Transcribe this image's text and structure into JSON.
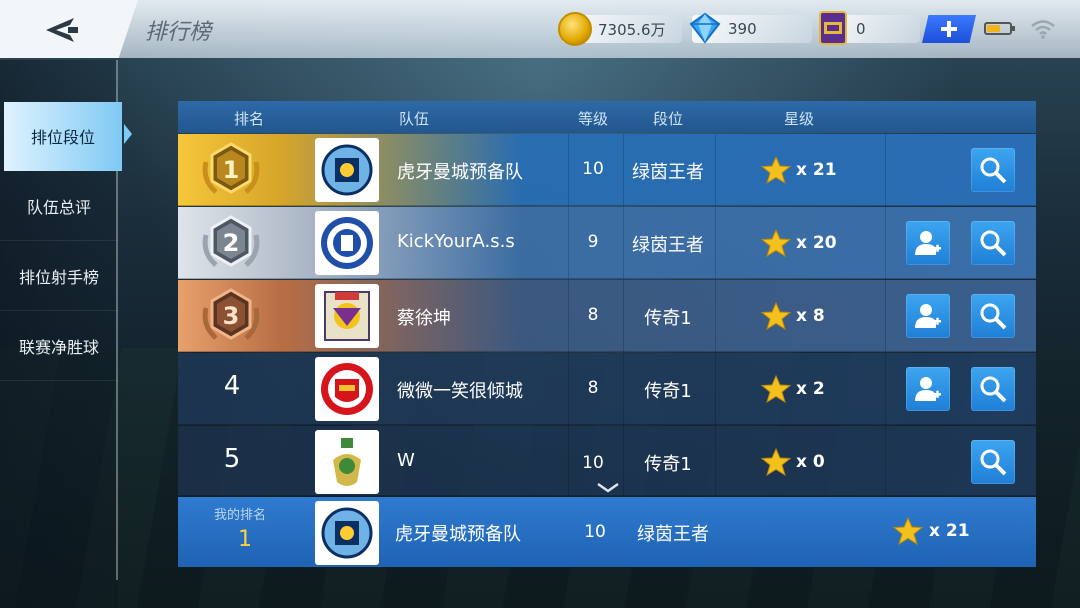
{
  "header": {
    "title": "排行榜",
    "coins": "7305.6万",
    "diamonds": "390",
    "cards": "0"
  },
  "sidebar": {
    "items": [
      {
        "label": "排位段位",
        "active": true
      },
      {
        "label": "队伍总评",
        "active": false
      },
      {
        "label": "排位射手榜",
        "active": false
      },
      {
        "label": "联赛净胜球",
        "active": false
      }
    ]
  },
  "table": {
    "headers": {
      "rank": "排名",
      "team": "队伍",
      "level": "等级",
      "tier": "段位",
      "stars": "星级"
    },
    "rows": [
      {
        "rank": "1",
        "team": "虎牙曼城预备队",
        "level": "10",
        "tier": "绿茵王者",
        "stars": "x 21",
        "medal": "gold",
        "add_friend": false
      },
      {
        "rank": "2",
        "team": "KickYourA.s.s",
        "level": "9",
        "tier": "绿茵王者",
        "stars": "x 20",
        "medal": "silver",
        "add_friend": true
      },
      {
        "rank": "3",
        "team": "蔡徐坤",
        "level": "8",
        "tier": "传奇1",
        "stars": "x 8",
        "medal": "bronze",
        "add_friend": true
      },
      {
        "rank": "4",
        "team": "微微一笑很倾城",
        "level": "8",
        "tier": "传奇1",
        "stars": "x 2",
        "medal": "",
        "add_friend": true
      },
      {
        "rank": "5",
        "team": "W",
        "level": "10",
        "tier": "传奇1",
        "stars": "x 0",
        "medal": "",
        "add_friend": false
      }
    ]
  },
  "my_rank": {
    "label": "我的排名",
    "rank": "1",
    "team": "虎牙曼城预备队",
    "level": "10",
    "tier": "绿茵王者",
    "stars": "x 21"
  },
  "colors": {
    "accent_blue": "#1f7fd6",
    "gold": "#f6c63a",
    "silver": "#c7ced8",
    "bronze": "#c97a4a",
    "my_rank_number": "#ffd13a"
  }
}
